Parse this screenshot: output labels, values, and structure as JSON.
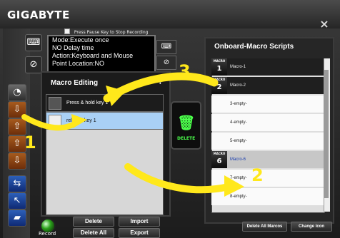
{
  "app": {
    "brand": "GIGABYTE",
    "close": "×"
  },
  "recording": {
    "checkbox_label": "Press Pause Key to Stop Recording"
  },
  "info": {
    "lines": [
      "Mode:Execute once",
      "NO Delay time",
      "Action:Keyboard and Mouse",
      "Point Location:NO"
    ]
  },
  "editor": {
    "title": "Macro Editing",
    "help": "?",
    "rows": [
      "Press & hold key 1",
      "release key 1"
    ],
    "buttons": [
      "Delete",
      "Import",
      "Delete All",
      "Export"
    ],
    "record_label": "Record"
  },
  "trash": {
    "label": "DELETE"
  },
  "scripts": {
    "title": "Onboard-Macro Scripts",
    "items": [
      {
        "tag": "MACRO",
        "number": "1",
        "label": "Macro-1",
        "style": "dark"
      },
      {
        "tag": "MACRO",
        "number": "2",
        "label": "Macro-2",
        "style": "dark"
      },
      {
        "tag": "",
        "number": "",
        "label": "3-empty-",
        "style": "light"
      },
      {
        "tag": "",
        "number": "",
        "label": "4-empty-",
        "style": "light"
      },
      {
        "tag": "",
        "number": "",
        "label": "5-empty-",
        "style": "light"
      },
      {
        "tag": "MACRO",
        "number": "6",
        "label": "Macro-6",
        "style": "gray"
      },
      {
        "tag": "",
        "number": "",
        "label": "7-empty-",
        "style": "light"
      },
      {
        "tag": "",
        "number": "",
        "label": "8-empty-",
        "style": "light"
      }
    ]
  },
  "footer": {
    "delete_all": "Delete All Marcos",
    "change_icon": "Change Icon"
  },
  "annotations": {
    "step1": "1",
    "step2": "2",
    "step3": "3"
  },
  "colors": {
    "accent": "#ffe81b",
    "green": "#4bff4b"
  }
}
